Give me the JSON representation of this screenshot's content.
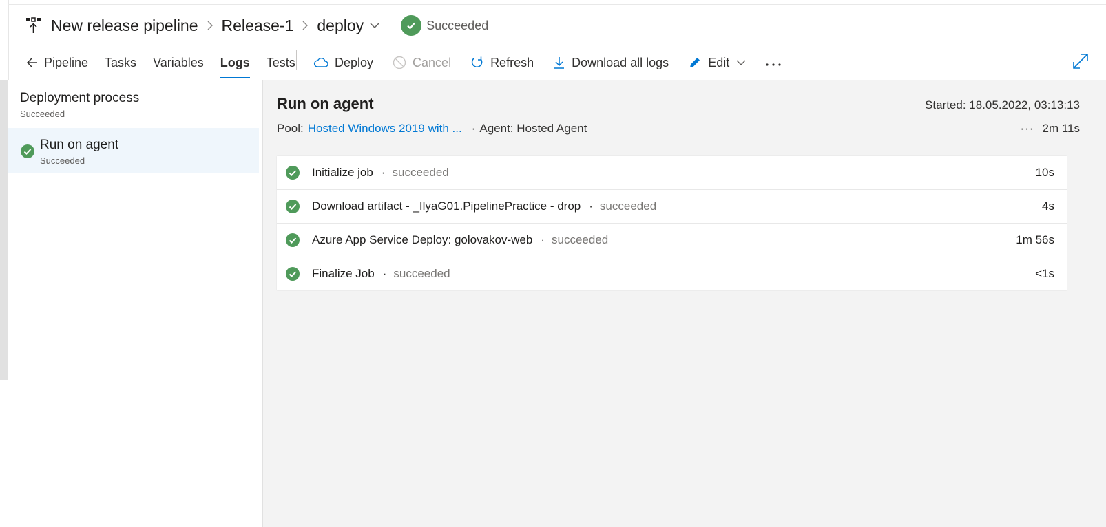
{
  "breadcrumb": {
    "pipeline": "New release pipeline",
    "release": "Release-1",
    "stage": "deploy",
    "status": "Succeeded"
  },
  "tabs": [
    {
      "label": "Pipeline"
    },
    {
      "label": "Tasks"
    },
    {
      "label": "Variables"
    },
    {
      "label": "Logs"
    },
    {
      "label": "Tests"
    }
  ],
  "actions": {
    "deploy": "Deploy",
    "cancel": "Cancel",
    "refresh": "Refresh",
    "download": "Download all logs",
    "edit": "Edit"
  },
  "sidebar": {
    "title": "Deployment process",
    "status": "Succeeded",
    "item": {
      "label": "Run on agent",
      "status": "Succeeded"
    }
  },
  "job": {
    "title": "Run on agent",
    "started": "Started: 18.05.2022, 03:13:13",
    "pool_label": "Pool:",
    "pool_value": "Hosted Windows 2019 with ...",
    "agent": "Agent: Hosted Agent",
    "duration": "2m 11s",
    "steps": [
      {
        "name": "Initialize job",
        "status": "succeeded",
        "duration": "10s"
      },
      {
        "name": "Download artifact - _IlyaG01.PipelinePractice - drop",
        "status": "succeeded",
        "duration": "4s"
      },
      {
        "name": "Azure App Service Deploy: golovakov-web",
        "status": "succeeded",
        "duration": "1m 56s"
      },
      {
        "name": "Finalize Job",
        "status": "succeeded",
        "duration": "<1s"
      }
    ]
  },
  "colors": {
    "success": "#4f9a5a",
    "accent": "#0078d4"
  }
}
